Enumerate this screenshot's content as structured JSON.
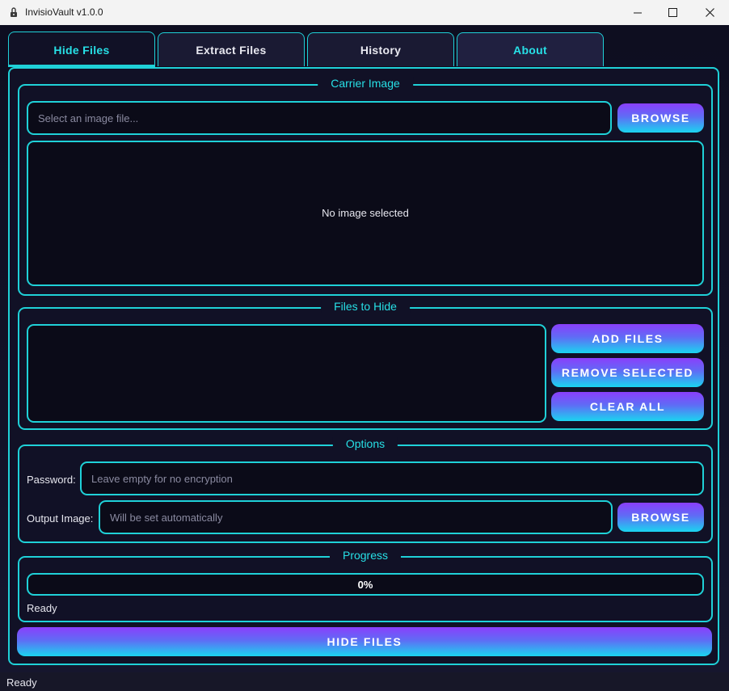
{
  "window": {
    "title": "InvisioVault v1.0.0",
    "controls": [
      "minimize-icon",
      "maximize-icon",
      "close-icon"
    ]
  },
  "tabs": [
    {
      "label": "Hide Files",
      "active": true
    },
    {
      "label": "Extract Files",
      "active": false
    },
    {
      "label": "History",
      "active": false
    },
    {
      "label": "About",
      "active": false
    }
  ],
  "carrier": {
    "title": "Carrier Image",
    "placeholder": "Select an image file...",
    "browse_label": "BROWSE",
    "preview_text": "No image selected"
  },
  "files": {
    "title": "Files to Hide",
    "add_label": "ADD FILES",
    "remove_label": "REMOVE SELECTED",
    "clear_label": "CLEAR ALL"
  },
  "options": {
    "title": "Options",
    "password_label": "Password:",
    "password_placeholder": "Leave empty for no encryption",
    "output_label": "Output Image:",
    "output_placeholder": "Will be set automatically",
    "browse_label": "BROWSE"
  },
  "progress": {
    "title": "Progress",
    "value_text": "0%",
    "value": 0,
    "status": "Ready"
  },
  "action": {
    "hide_label": "HIDE FILES"
  },
  "statusbar": {
    "text": "Ready"
  },
  "colors": {
    "accent": "#1fd1d8",
    "background": "#0c0c1a",
    "button_gradient_top": "#8a3ffc",
    "button_gradient_bottom": "#1ad5f0"
  }
}
